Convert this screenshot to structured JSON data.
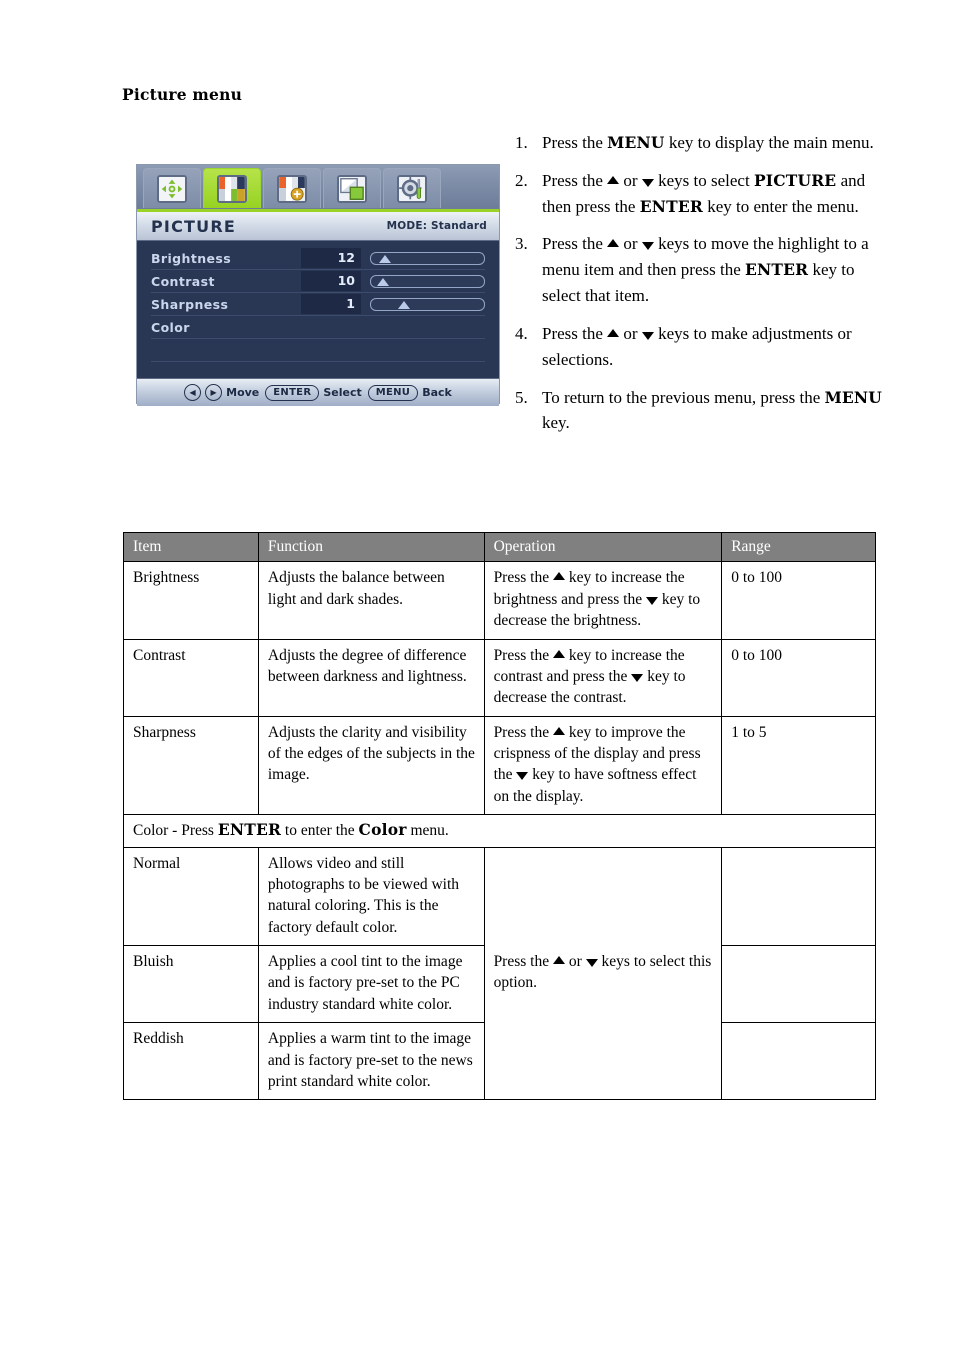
{
  "page": {
    "heading": "Picture menu"
  },
  "osd": {
    "tabs": [
      {
        "name": "display-position-icon",
        "label": "Display",
        "selected": false
      },
      {
        "name": "picture-icon",
        "label": "Picture",
        "selected": true
      },
      {
        "name": "picture-advanced-icon",
        "label": "Picture Advanced",
        "selected": false
      },
      {
        "name": "pip-icon",
        "label": "PIP",
        "selected": false
      },
      {
        "name": "system-settings-icon",
        "label": "System",
        "selected": false
      }
    ],
    "title": "PICTURE",
    "mode": "MODE: Standard",
    "rows": [
      {
        "label": "Brightness",
        "value": "12",
        "slider": 12
      },
      {
        "label": "Contrast",
        "value": "10",
        "slider": 10
      },
      {
        "label": "Sharpness",
        "value": "1",
        "slider": 28
      },
      {
        "label": "Color",
        "value": "",
        "slider": null
      }
    ],
    "footer": {
      "left_arrow": "◀",
      "right_arrow": "▶",
      "move_label": "Move",
      "enter_key": "ENTER",
      "select_label": "Select",
      "menu_key": "MENU",
      "back_label": "Back"
    }
  },
  "steps": [
    {
      "num": "1.",
      "parts": [
        {
          "t": "Press the "
        },
        {
          "t": "MENU",
          "b": true
        },
        {
          "t": " key to display the main menu."
        }
      ]
    },
    {
      "num": "2.",
      "parts": [
        {
          "t": "Press the "
        },
        {
          "t": "",
          "icon": "up"
        },
        {
          "t": " or "
        },
        {
          "t": "",
          "icon": "down"
        },
        {
          "t": " keys to select "
        },
        {
          "t": "PICTURE",
          "b": true
        },
        {
          "t": " and then press the "
        },
        {
          "t": "ENTER",
          "b": true
        },
        {
          "t": " key to enter the menu."
        }
      ]
    },
    {
      "num": "3.",
      "parts": [
        {
          "t": "Press the "
        },
        {
          "t": "",
          "icon": "up"
        },
        {
          "t": " or "
        },
        {
          "t": "",
          "icon": "down"
        },
        {
          "t": " keys to move the highlight to a menu item and then press the "
        },
        {
          "t": "ENTER",
          "b": true
        },
        {
          "t": " key to select that item."
        }
      ]
    },
    {
      "num": "4.",
      "parts": [
        {
          "t": "Press the "
        },
        {
          "t": "",
          "icon": "up"
        },
        {
          "t": " or "
        },
        {
          "t": "",
          "icon": "down"
        },
        {
          "t": " keys to make adjustments or selections."
        }
      ]
    },
    {
      "num": "5.",
      "parts": [
        {
          "t": "To return to the previous menu, press the "
        },
        {
          "t": "MENU",
          "b": true
        },
        {
          "t": " key."
        }
      ]
    }
  ],
  "table": {
    "headers": [
      "Item",
      "Function",
      "Operation",
      "Range"
    ],
    "rows": [
      {
        "item": "Brightness",
        "function": "Adjusts the balance between light and dark shades.",
        "operation_parts": [
          {
            "t": "Press the "
          },
          {
            "t": "",
            "icon": "up"
          },
          {
            "t": " key to increase the brightness and press the "
          },
          {
            "t": "",
            "icon": "down"
          },
          {
            "t": " key to decrease the brightness."
          }
        ],
        "range": "0 to 100"
      },
      {
        "item": "Contrast",
        "function": "Adjusts the degree of difference between darkness and lightness.",
        "operation_parts": [
          {
            "t": "Press the "
          },
          {
            "t": "",
            "icon": "up"
          },
          {
            "t": " key to increase the contrast and press the "
          },
          {
            "t": "",
            "icon": "down"
          },
          {
            "t": " key to decrease the contrast."
          }
        ],
        "range": "0 to 100"
      },
      {
        "item": "Sharpness",
        "function": "Adjusts the clarity and visibility of the edges of the subjects in the image.",
        "operation_parts": [
          {
            "t": "Press the "
          },
          {
            "t": "",
            "icon": "up"
          },
          {
            "t": " key to improve the crispness of the display and press the "
          },
          {
            "t": "",
            "icon": "down"
          },
          {
            "t": " key to have softness effect on the display."
          }
        ],
        "range": "1 to 5"
      }
    ],
    "color_section_parts": [
      {
        "t": "Color - Press "
      },
      {
        "t": "ENTER",
        "b": true
      },
      {
        "t": " to enter the "
      },
      {
        "t": "Color",
        "b": true
      },
      {
        "t": " menu."
      }
    ],
    "color_rows": [
      {
        "item": "Normal",
        "function": "Allows video and still photographs to be viewed with natural coloring. This is the factory default color.",
        "range": ""
      },
      {
        "item": "Bluish",
        "function": "Applies a cool tint to the image and is factory pre-set to the PC industry standard white color.",
        "range": ""
      },
      {
        "item": "Reddish",
        "function": "Applies a warm tint to the image and is factory pre-set to the news print standard white color.",
        "range": ""
      }
    ],
    "color_operation_parts": [
      {
        "t": "Press the "
      },
      {
        "t": "",
        "icon": "up"
      },
      {
        "t": " or "
      },
      {
        "t": "",
        "icon": "down"
      },
      {
        "t": " keys to select this option."
      }
    ]
  }
}
